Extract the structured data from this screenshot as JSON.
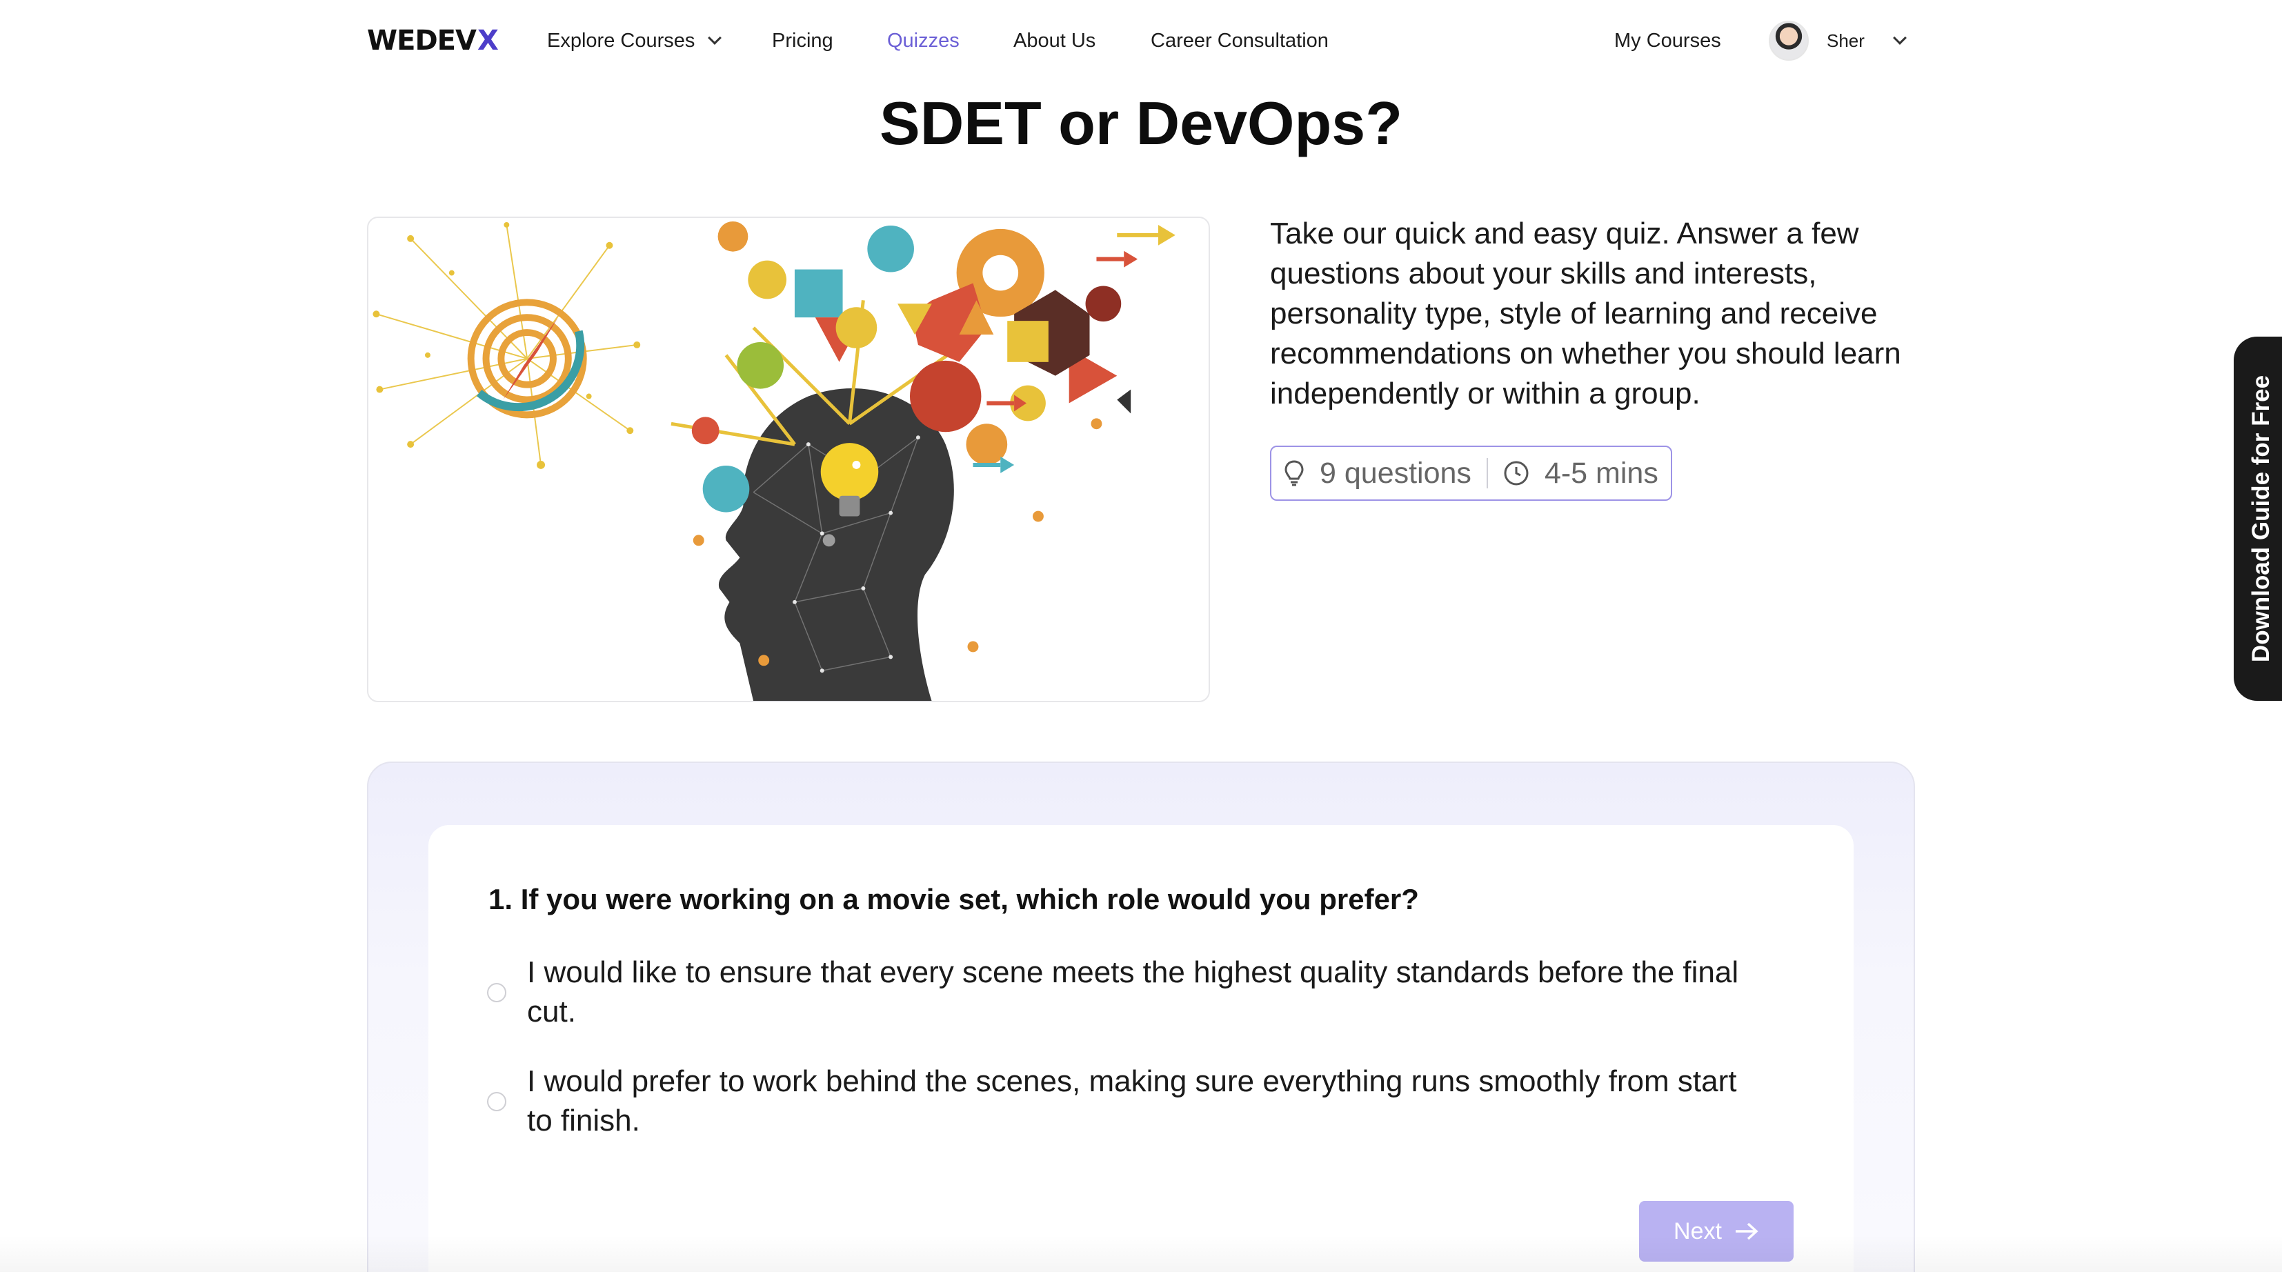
{
  "nav": {
    "logo_main": "WEDEV",
    "logo_accent": "X",
    "explore": "Explore Courses",
    "pricing": "Pricing",
    "quizzes": "Quizzes",
    "about": "About Us",
    "career": "Career Consultation",
    "my_courses": "My Courses",
    "user_name": "Sher",
    "active_color": "#6b5fd6"
  },
  "page": {
    "title": "SDET or DevOps?",
    "description": "Take our quick and easy quiz. Answer a few questions about your skills and interests, personality type, style of learning and receive recommendations on whether you should learn independently or within a group.",
    "questions_count": "9 questions",
    "duration": "4-5 mins",
    "download_tab": "Download Guide for Free"
  },
  "quiz": {
    "question": "1. If you were working on a movie set, which role would you prefer?",
    "options": [
      "I would like to ensure that every scene meets the highest quality standards before the final cut.",
      "I would prefer to work behind the scenes, making sure everything runs smoothly from start to finish."
    ],
    "next_label": "Next",
    "accent_color": "#b9b2f2"
  },
  "icons": {
    "meta_questions": "lightbulb-icon",
    "meta_duration": "clock-icon",
    "nav_dropdown": "chevron-down-icon",
    "next": "arrow-right-icon"
  }
}
